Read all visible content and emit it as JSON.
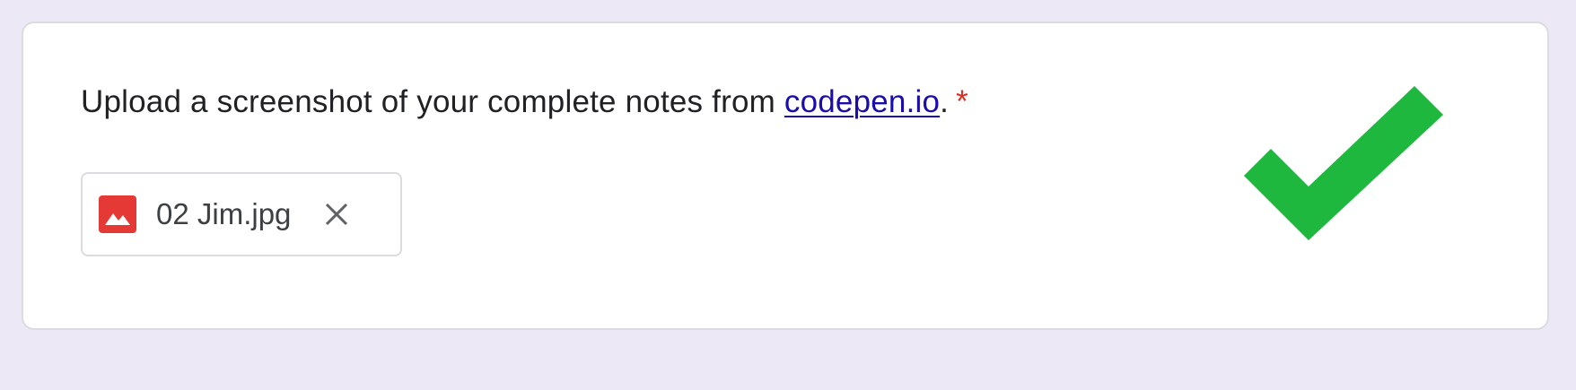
{
  "question": {
    "text_before": "Upload a screenshot of your complete notes from ",
    "link_text": "codepen.io",
    "text_after": ".",
    "required_marker": "*"
  },
  "upload": {
    "file_name": "02 Jim.jpg",
    "file_icon": "image-file-icon",
    "remove_icon": "close-icon"
  },
  "status": {
    "icon": "checkmark-icon",
    "color": "#1fb83f"
  },
  "colors": {
    "background": "#ece8f6",
    "card": "#ffffff",
    "link": "#1a0dab",
    "required": "#d93025",
    "file_icon": "#e53935"
  }
}
